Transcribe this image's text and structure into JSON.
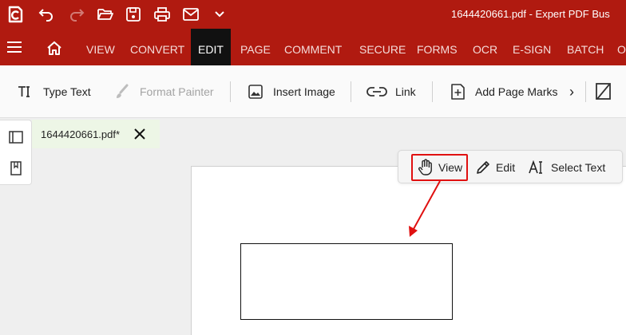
{
  "title_bar": {
    "quick_access": [
      "app-logo-icon",
      "undo-icon",
      "redo-icon",
      "open-folder-icon",
      "save-icon",
      "print-icon",
      "email-icon",
      "customize-dropdown-icon"
    ],
    "title": "1644420661.pdf  -  Expert PDF Bus"
  },
  "menu": {
    "items": [
      "VIEW",
      "CONVERT",
      "EDIT",
      "PAGE",
      "COMMENT",
      "SECURE",
      "FORMS",
      "OCR",
      "E-SIGN",
      "BATCH",
      "O"
    ],
    "active": "EDIT"
  },
  "ribbon": {
    "type_text": "Type Text",
    "format_painter": "Format Painter",
    "insert_image": "Insert Image",
    "link": "Link",
    "add_page_marks": "Add Page Marks",
    "more_arrow": "›"
  },
  "tab": {
    "filename": "1644420661.pdf*"
  },
  "mode_toolbar": {
    "view": "View",
    "edit": "Edit",
    "select_text": "Select Text",
    "selected": "View"
  },
  "colors": {
    "brand_red": "#b01a10",
    "active_menu_bg": "#111111",
    "highlight_red": "#e01010",
    "tab_bg": "#edf6e6"
  }
}
